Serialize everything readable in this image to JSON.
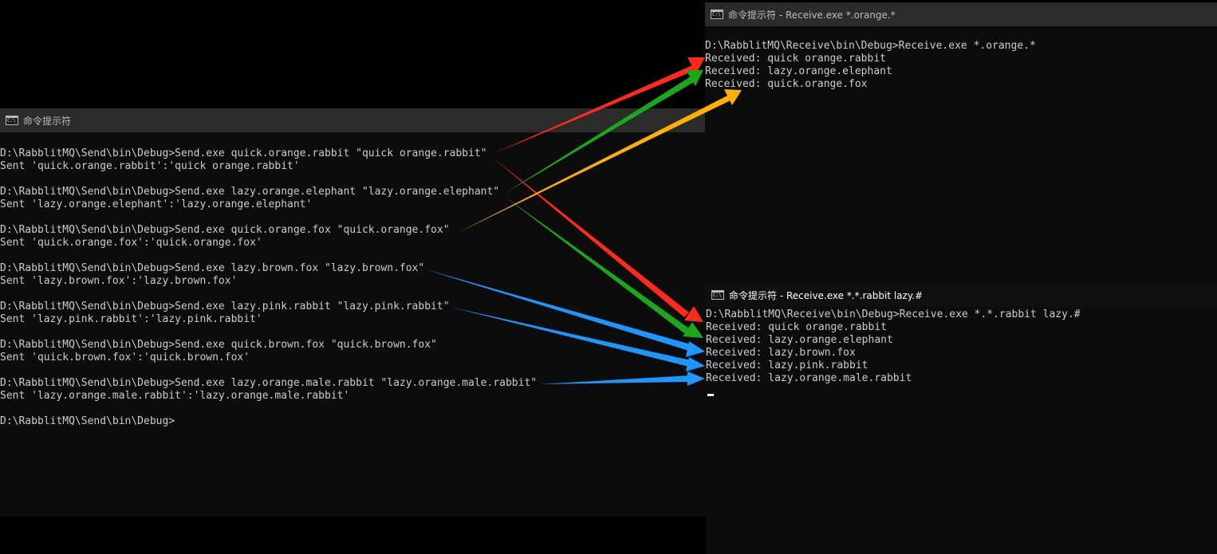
{
  "send_window": {
    "title": "命令提示符",
    "lines": [
      "",
      "D:\\RabblitMQ\\Send\\bin\\Debug>Send.exe quick.orange.rabbit \"quick orange.rabbit\"",
      "Sent 'quick.orange.rabbit':'quick orange.rabbit'",
      "",
      "D:\\RabblitMQ\\Send\\bin\\Debug>Send.exe lazy.orange.elephant \"lazy.orange.elephant\"",
      "Sent 'lazy.orange.elephant':'lazy.orange.elephant'",
      "",
      "D:\\RabblitMQ\\Send\\bin\\Debug>Send.exe quick.orange.fox \"quick.orange.fox\"",
      "Sent 'quick.orange.fox':'quick.orange.fox'",
      "",
      "D:\\RabblitMQ\\Send\\bin\\Debug>Send.exe lazy.brown.fox \"lazy.brown.fox\"",
      "Sent 'lazy.brown.fox':'lazy.brown.fox'",
      "",
      "D:\\RabblitMQ\\Send\\bin\\Debug>Send.exe lazy.pink.rabbit \"lazy.pink.rabbit\"",
      "Sent 'lazy.pink.rabbit':'lazy.pink.rabbit'",
      "",
      "D:\\RabblitMQ\\Send\\bin\\Debug>Send.exe quick.brown.fox \"quick.brown.fox\"",
      "Sent 'quick.brown.fox':'quick.brown.fox'",
      "",
      "D:\\RabblitMQ\\Send\\bin\\Debug>Send.exe lazy.orange.male.rabbit \"lazy.orange.male.rabbit\"",
      "Sent 'lazy.orange.male.rabbit':'lazy.orange.male.rabbit'",
      "",
      "D:\\RabblitMQ\\Send\\bin\\Debug>"
    ]
  },
  "receive_window_1": {
    "title": "命令提示符 - Receive.exe  *.orange.*",
    "lines": [
      "",
      "D:\\RabblitMQ\\Receive\\bin\\Debug>Receive.exe *.orange.*",
      "Received: quick orange.rabbit",
      "Received: lazy.orange.elephant",
      "Received: quick.orange.fox"
    ]
  },
  "receive_window_2": {
    "title": "命令提示符 - Receive.exe  *.*.rabbit lazy.#",
    "lines": [
      "D:\\RabblitMQ\\Receive\\bin\\Debug>Receive.exe *.*.rabbit lazy.#",
      "Received: quick orange.rabbit",
      "Received: lazy.orange.elephant",
      "Received: lazy.brown.fox",
      "Received: lazy.pink.rabbit",
      "Received: lazy.orange.male.rabbit"
    ]
  },
  "arrow_colors": {
    "red": "#ff2a1a",
    "green": "#1aa81a",
    "orange": "#ffb000",
    "blue": "#1e96ff"
  }
}
